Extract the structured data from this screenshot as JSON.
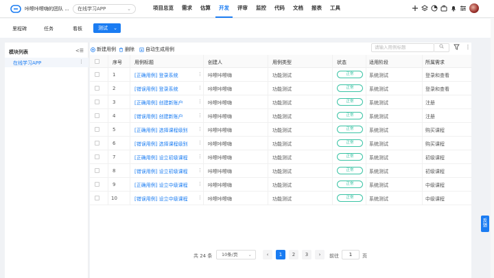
{
  "header": {
    "team_name": "咔嚓咔嚓嗨的团队 ...",
    "project": "在线学习APP",
    "menu": [
      "项目总览",
      "需求",
      "估算",
      "开发",
      "评审",
      "监控",
      "代码",
      "文档",
      "报表",
      "工具"
    ],
    "active_menu": "开发"
  },
  "subnav": {
    "tabs": [
      "里程碑",
      "任务",
      "看板"
    ],
    "active_tab": "测试"
  },
  "sidebar": {
    "title": "模块列表",
    "items": [
      {
        "label": "在线学习APP"
      }
    ]
  },
  "toolbar": {
    "new_case": "新建用例",
    "delete": "删除",
    "auto_generate": "自动生成用例",
    "search_placeholder": "请输入用例标题"
  },
  "table": {
    "columns": [
      "序号",
      "用例标题",
      "创建人",
      "用例类型",
      "状态",
      "适用阶段",
      "所属需求"
    ],
    "rows": [
      {
        "no": "1",
        "title": "[正确用例] 登录系统",
        "creator": "咔嚓咔嚓嗨",
        "type": "功能测试",
        "status": "正常",
        "stage": "系统测试",
        "req": "登录和查看"
      },
      {
        "no": "2",
        "title": "[错误用例] 登录系统",
        "creator": "咔嚓咔嚓嗨",
        "type": "功能测试",
        "status": "正常",
        "stage": "系统测试",
        "req": "登录和查看"
      },
      {
        "no": "3",
        "title": "[正确用例] 创建新账户",
        "creator": "咔嚓咔嚓嗨",
        "type": "功能测试",
        "status": "正常",
        "stage": "系统测试",
        "req": "注册"
      },
      {
        "no": "4",
        "title": "[错误用例] 创建新账户",
        "creator": "咔嚓咔嚓嗨",
        "type": "功能测试",
        "status": "正常",
        "stage": "系统测试",
        "req": "注册"
      },
      {
        "no": "5",
        "title": "[正确用例] 选择课程级别",
        "creator": "咔嚓咔嚓嗨",
        "type": "功能测试",
        "status": "正常",
        "stage": "系统测试",
        "req": "购买课程"
      },
      {
        "no": "6",
        "title": "[错误用例] 选择课程级别",
        "creator": "咔嚓咔嚓嗨",
        "type": "功能测试",
        "status": "正常",
        "stage": "系统测试",
        "req": "购买课程"
      },
      {
        "no": "7",
        "title": "[正确用例] 设立初级课程",
        "creator": "咔嚓咔嚓嗨",
        "type": "功能测试",
        "status": "正常",
        "stage": "系统测试",
        "req": "初级课程"
      },
      {
        "no": "8",
        "title": "[错误用例] 设立初级课程",
        "creator": "咔嚓咔嚓嗨",
        "type": "功能测试",
        "status": "正常",
        "stage": "系统测试",
        "req": "初级课程"
      },
      {
        "no": "9",
        "title": "[正确用例] 设立中级课程",
        "creator": "咔嚓咔嚓嗨",
        "type": "功能测试",
        "status": "正常",
        "stage": "系统测试",
        "req": "中级课程"
      },
      {
        "no": "10",
        "title": "[错误用例] 设立中级课程",
        "creator": "咔嚓咔嚓嗨",
        "type": "功能测试",
        "status": "正常",
        "stage": "系统测试",
        "req": "中级课程"
      }
    ]
  },
  "pagination": {
    "total": "共 24 条",
    "page_size": "10条/页",
    "pages": [
      "1",
      "2",
      "3"
    ],
    "current_page": "1",
    "prev": "‹",
    "next": "›",
    "goto_label": "前往",
    "goto_value": "1",
    "goto_unit": "页"
  },
  "feedback": "反馈",
  "colors": {
    "accent": "#1a7cf2",
    "status_ok": "#37c2a3"
  }
}
